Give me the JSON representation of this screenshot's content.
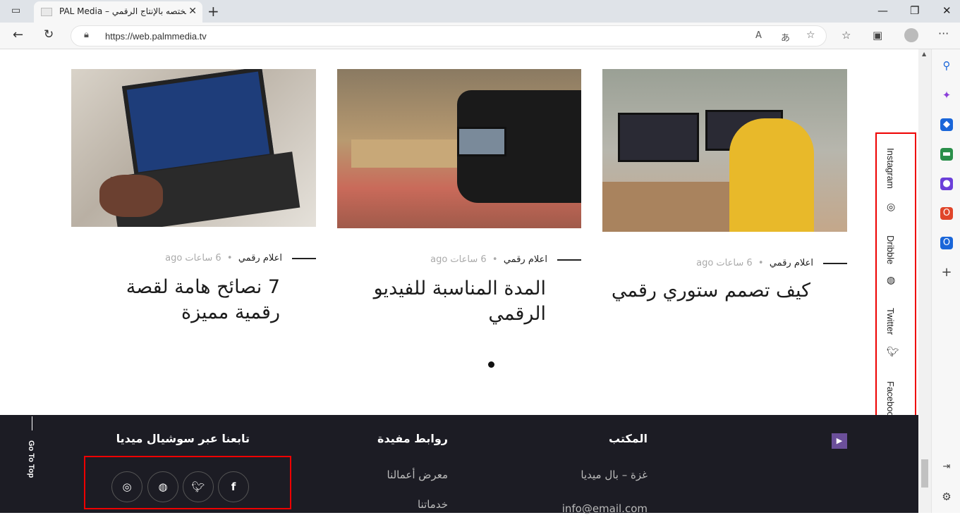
{
  "browser": {
    "tab_title": "PAL Media – مختصه بالإنتاج الرقمي",
    "url": "https://web.palmmedia.tv"
  },
  "cards": [
    {
      "category": "اعلام رقمي",
      "time": "6 ساعات ago",
      "title_line1": "كيف تصمم ستوري رقمي",
      "title_line2": ""
    },
    {
      "category": "اعلام رقمي",
      "time": "6 ساعات ago",
      "title_line1": "المدة المناسبة للفيديو",
      "title_line2": "الرقمي"
    },
    {
      "category": "اعلام رقمي",
      "time": "6 ساعات ago",
      "title_line1": "7 نصائح هامة لقصة",
      "title_line2": "رقمية مميزة"
    }
  ],
  "float_social": {
    "instagram": "Instagram",
    "dribble": "Dribble",
    "twitter": "Twitter",
    "facebook": "Facebook"
  },
  "footer": {
    "office_head": "المكتب",
    "office_line1": "غزة – بال ميديا",
    "office_line2": "info@email.com",
    "links_head": "روابط مفيدة",
    "link1": "معرض أعمالنا",
    "link2": "خدماتنا",
    "social_head": "تابعنا عبر سوشيال ميديا",
    "go_top": "Go To Top"
  }
}
